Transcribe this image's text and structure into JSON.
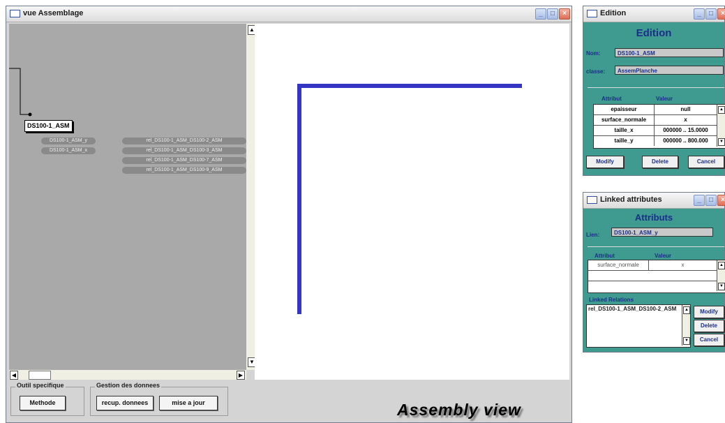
{
  "main_window": {
    "title": "vue Assemblage",
    "controls": {
      "min": "_",
      "max": "□",
      "close": "×"
    },
    "graph": {
      "main_node": "DS100-1_ASM",
      "attribute_nodes": [
        "DS100-1_ASM_y",
        "DS100-1_ASM_x"
      ],
      "relation_nodes": [
        "rel_DS100-1_ASM_DS100-2_ASM",
        "rel_DS100-1_ASM_DS100-3_ASM",
        "rel_DS100-1_ASM_DS100-7_ASM",
        "rel_DS100-1_ASM_DS100-9_ASM"
      ]
    },
    "toolbar": {
      "group1_label": "Outil specifique",
      "methode_button": "Methode",
      "group2_label": "Gestion des donnees",
      "recup_button": "recup. donnees",
      "miseajour_button": "mise a jour"
    },
    "caption": "Assembly view"
  },
  "edition_window": {
    "title": "Edition",
    "heading": "Edition",
    "nom_label": "Nom:",
    "nom_value": "DS100-1_ASM",
    "classe_label": "classe:",
    "classe_value": "AssemPlanche",
    "col_attribut": "Attribut",
    "col_valeur": "Valeur",
    "rows": [
      {
        "attribut": "epaisseur",
        "valeur": "null"
      },
      {
        "attribut": "surface_normale",
        "valeur": "x"
      },
      {
        "attribut": "taille_x",
        "valeur": "000000 .. 15.0000"
      },
      {
        "attribut": "taille_y",
        "valeur": "000000 .. 800.000"
      }
    ],
    "modify_button": "Modify",
    "delete_button": "Delete",
    "cancel_button": "Cancel"
  },
  "linked_window": {
    "title": "Linked attributes",
    "heading": "Attributs",
    "lien_label": "Lien:",
    "lien_value": "DS100-1_ASM_y",
    "col_attribut": "Attribut",
    "col_valeur": "Valeur",
    "rows": [
      {
        "attribut": "surface_normale",
        "valeur": "x"
      }
    ],
    "linked_relations_label": "Linked Relations",
    "linked_relations": [
      "rel_DS100-1_ASM_DS100-2_ASM"
    ],
    "modify_button": "Modify",
    "delete_button": "Delete",
    "cancel_button": "Cancel"
  }
}
